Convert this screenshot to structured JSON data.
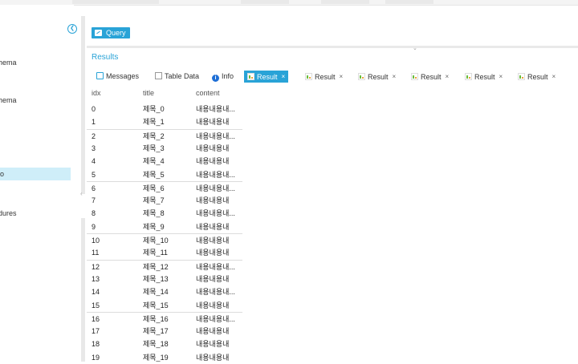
{
  "sidebar": {
    "items": [
      {
        "label": "hema",
        "selected": false
      },
      {
        "label": "hema",
        "selected": false
      },
      {
        "label": "lo",
        "selected": true
      },
      {
        "label": "dures",
        "selected": false
      }
    ]
  },
  "toolbar": {
    "query_label": "Query"
  },
  "results": {
    "title": "Results",
    "tabs": [
      {
        "label": "Messages",
        "icon": "messages-icon",
        "closable": false,
        "active": false
      },
      {
        "label": "Table Data",
        "icon": "table-icon",
        "closable": false,
        "active": false
      },
      {
        "label": "Info",
        "icon": "info-icon",
        "closable": false,
        "active": false
      },
      {
        "label": "Result",
        "icon": "result-icon",
        "closable": true,
        "active": true
      },
      {
        "label": "Result",
        "icon": "result-icon",
        "closable": true,
        "active": false
      },
      {
        "label": "Result",
        "icon": "result-icon",
        "closable": true,
        "active": false
      },
      {
        "label": "Result",
        "icon": "result-icon",
        "closable": true,
        "active": false
      },
      {
        "label": "Result",
        "icon": "result-icon",
        "closable": true,
        "active": false
      },
      {
        "label": "Result",
        "icon": "result-icon",
        "closable": true,
        "active": false
      }
    ],
    "close_glyph": "×",
    "columns": [
      "idx",
      "title",
      "content"
    ],
    "rows": [
      [
        "0",
        "제목_0",
        "내용내용내..."
      ],
      [
        "1",
        "제목_1",
        "내용내용내"
      ],
      [
        "2",
        "제목_2",
        "내용내용내..."
      ],
      [
        "3",
        "제목_3",
        "내용내용내"
      ],
      [
        "4",
        "제목_4",
        "내용내용내"
      ],
      [
        "5",
        "제목_5",
        "내용내용내..."
      ],
      [
        "6",
        "제목_6",
        "내용내용내..."
      ],
      [
        "7",
        "제목_7",
        "내용내용내"
      ],
      [
        "8",
        "제목_8",
        "내용내용내..."
      ],
      [
        "9",
        "제목_9",
        "내용내용내"
      ],
      [
        "10",
        "제목_10",
        "내용내용내"
      ],
      [
        "11",
        "제목_11",
        "내용내용내"
      ],
      [
        "12",
        "제목_12",
        "내용내용내..."
      ],
      [
        "13",
        "제목_13",
        "내용내용내"
      ],
      [
        "14",
        "제목_14",
        "내용내용내..."
      ],
      [
        "15",
        "제목_15",
        "내용내용내"
      ],
      [
        "16",
        "제목_16",
        "내용내용내..."
      ],
      [
        "17",
        "제목_17",
        "내용내용내"
      ],
      [
        "18",
        "제목_18",
        "내용내용내"
      ],
      [
        "19",
        "제목_19",
        "내용내용내"
      ]
    ],
    "separator_before_rows": [
      2,
      6,
      10,
      12,
      16
    ]
  },
  "colors": {
    "accent": "#29a3d7",
    "selected_bg": "#cfeef9",
    "splitter": "#e8e8e8"
  }
}
